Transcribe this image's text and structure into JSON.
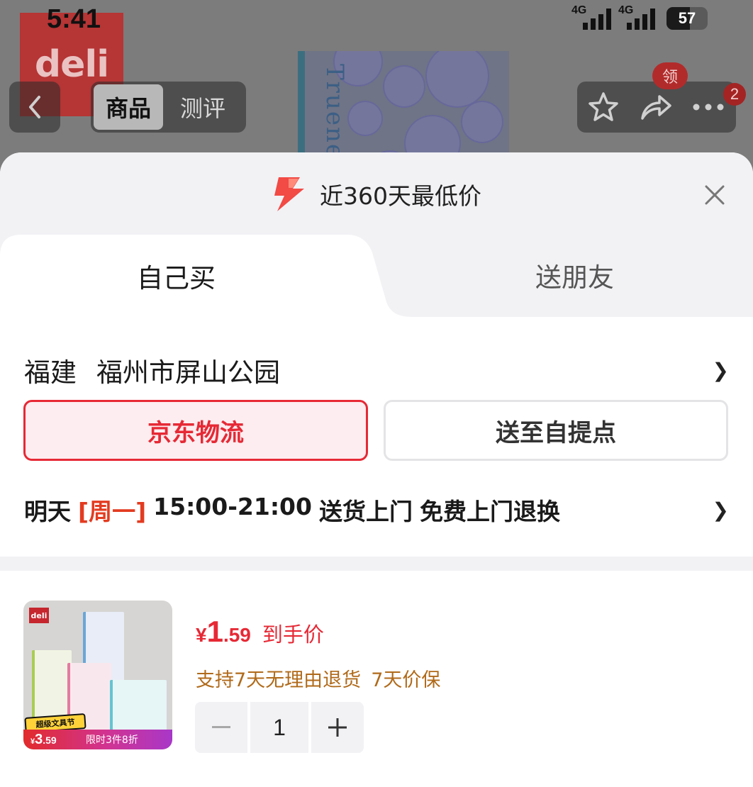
{
  "status_bar": {
    "time": "5:41",
    "network_1": "4G",
    "network_2": "4G",
    "battery": "57",
    "battery_level_percent": 57
  },
  "header": {
    "back_icon": "chevron-left-icon",
    "brand_logo": "deli",
    "product_photo_text": "Truene",
    "tabs": [
      {
        "label": "商品",
        "active": true
      },
      {
        "label": "测评",
        "active": false
      }
    ],
    "actions": {
      "favorite_icon": "star-icon",
      "share_icon": "share-icon",
      "more_icon": "more-icon",
      "coupon_badge": "领",
      "message_count": "2"
    }
  },
  "sheet": {
    "banner": "近360天最低价",
    "banner_icon": "lightning-icon",
    "close_icon": "close-icon",
    "purchase_tabs": [
      {
        "label": "自己买",
        "active": true
      },
      {
        "label": "送朋友",
        "active": false
      }
    ],
    "address": {
      "province": "福建",
      "detail": "福州市屏山公园"
    },
    "shipping_options": [
      {
        "label": "京东物流",
        "selected": true
      },
      {
        "label": "送至自提点",
        "selected": false
      }
    ],
    "delivery": {
      "day": "明天",
      "weekday": "[周一]",
      "window": "15:00-21:00",
      "service": "送货上门",
      "returns": "免费上门退换"
    }
  },
  "product": {
    "thumb_logo": "deli",
    "thumb_festival": "超级文具节",
    "thumb_promo_currency": "¥",
    "thumb_promo_int": "3",
    "thumb_promo_dec": ".59",
    "thumb_promo_text": "限时3件8折",
    "price_currency": "¥",
    "price_int": "1",
    "price_dec": ".59",
    "price_label": "到手价",
    "services": [
      "支持7天无理由退货",
      "7天价保"
    ],
    "quantity": "1"
  },
  "colors": {
    "accent_red": "#e62935",
    "selected_bg": "#fdedf0",
    "service_brown": "#b06a1a",
    "weekday_orange": "#e33b20",
    "sheet_gray": "#f2f2f5"
  }
}
